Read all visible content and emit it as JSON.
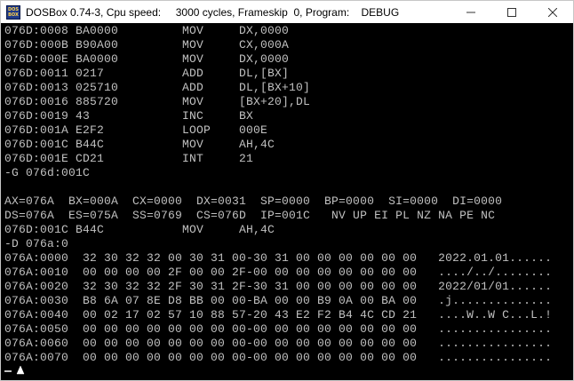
{
  "window": {
    "title": "DOSBox 0.74-3, Cpu speed:     3000 cycles, Frameskip  0, Program:    DEBUG",
    "icon_text_top": "DOS",
    "icon_text_bottom": "BOX",
    "controls": [
      "minimize-icon",
      "maximize-icon",
      "close-icon"
    ]
  },
  "colors": {
    "screen_bg": "#000000",
    "text": "#c0c0c0",
    "titlebar_bg": "#ffffff"
  },
  "console": {
    "lines": [
      "076D:0008 BA0000         MOV     DX,0000",
      "076D:000B B90A00         MOV     CX,000A",
      "076D:000E BA0000         MOV     DX,0000",
      "076D:0011 0217           ADD     DL,[BX]",
      "076D:0013 025710         ADD     DL,[BX+10]",
      "076D:0016 885720         MOV     [BX+20],DL",
      "076D:0019 43             INC     BX",
      "076D:001A E2F2           LOOP    000E",
      "076D:001C B44C           MOV     AH,4C",
      "076D:001E CD21           INT     21",
      "-G 076d:001C",
      "",
      "AX=076A  BX=000A  CX=0000  DX=0031  SP=0000  BP=0000  SI=0000  DI=0000",
      "DS=076A  ES=075A  SS=0769  CS=076D  IP=001C   NV UP EI PL NZ NA PE NC",
      "076D:001C B44C           MOV     AH,4C",
      "-D 076a:0",
      "076A:0000  32 30 32 32 00 30 31 00-30 31 00 00 00 00 00 00   2022.01.01......",
      "076A:0010  00 00 00 00 2F 00 00 2F-00 00 00 00 00 00 00 00   ..../../........",
      "076A:0020  32 30 32 32 2F 30 31 2F-30 31 00 00 00 00 00 00   2022/01/01......",
      "076A:0030  B8 6A 07 8E D8 BB 00 00-BA 00 00 B9 0A 00 BA 00   .j..............",
      "076A:0040  00 02 17 02 57 10 88 57-20 43 E2 F2 B4 4C CD 21   ....W..W C...L.!",
      "076A:0050  00 00 00 00 00 00 00 00-00 00 00 00 00 00 00 00   ................",
      "076A:0060  00 00 00 00 00 00 00 00-00 00 00 00 00 00 00 00   ................",
      "076A:0070  00 00 00 00 00 00 00 00-00 00 00 00 00 00 00 00   ................",
      "-"
    ]
  }
}
